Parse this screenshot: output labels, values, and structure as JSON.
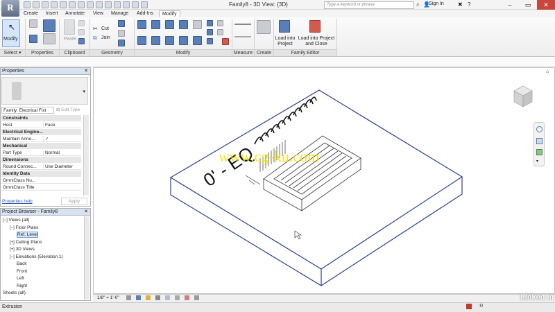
{
  "window": {
    "title": "Family8 - 3D View: {3D}",
    "search_placeholder": "Type a keyword or phrase",
    "sign_in": "Sign In",
    "app_letter": "R"
  },
  "ribbon_tabs": [
    "Create",
    "Insert",
    "Annotate",
    "View",
    "Manage",
    "Add-Ins",
    "Modify"
  ],
  "ribbon": {
    "modify_button": "Modify",
    "select_dropdown": "Select",
    "panels": [
      "Properties",
      "Clipboard",
      "Geometry",
      "Modify",
      "Measure",
      "Create",
      "Family Editor"
    ],
    "paste_label": "Paste",
    "cut_label": "Cut",
    "join_label": "Join",
    "load_project": "Load into Project",
    "load_project_close": "Load into Project and Close"
  },
  "properties": {
    "title": "Properties",
    "family_selector": "Family: Electrical Fixt",
    "edit_type": "Edit Type",
    "rows": [
      {
        "group": "Constraints"
      },
      {
        "k": "Host",
        "v": "Face"
      },
      {
        "group": "Electrical Engine..."
      },
      {
        "k": "Maintain Anno...",
        "v": "✓"
      },
      {
        "group": "Mechanical"
      },
      {
        "k": "Part Type",
        "v": "Normal"
      },
      {
        "group": "Dimensions"
      },
      {
        "k": "Round Connec...",
        "v": "Use Diameter"
      },
      {
        "group": "Identity Data"
      },
      {
        "k": "OmniClass Nu...",
        "v": ""
      },
      {
        "k": "OmniClass Title",
        "v": ""
      }
    ],
    "help_link": "Properties help",
    "apply_button": "Apply"
  },
  "project_browser": {
    "title": "Project Browser - Family8",
    "items": [
      {
        "label": "Views (all)",
        "indent": 0,
        "toggle": "−"
      },
      {
        "label": "Floor Plans",
        "indent": 1,
        "toggle": "−"
      },
      {
        "label": "Ref. Level",
        "indent": 2,
        "toggle": "",
        "selected": true
      },
      {
        "label": "Ceiling Plans",
        "indent": 1,
        "toggle": "+"
      },
      {
        "label": "3D Views",
        "indent": 1,
        "toggle": "+"
      },
      {
        "label": "Elevations (Elevation 1)",
        "indent": 1,
        "toggle": "−"
      },
      {
        "label": "Back",
        "indent": 2,
        "toggle": ""
      },
      {
        "label": "Front",
        "indent": 2,
        "toggle": ""
      },
      {
        "label": "Left",
        "indent": 2,
        "toggle": ""
      },
      {
        "label": "Right",
        "indent": 2,
        "toggle": ""
      },
      {
        "label": "Sheets (all)",
        "indent": 0,
        "toggle": ""
      }
    ]
  },
  "view": {
    "dimension_text": "0' - EQ",
    "watermark": "www.cg-ku.com",
    "scale": "1/8\" = 1'-0\""
  },
  "status": {
    "left_text": "Extrusion",
    "count": ":0"
  },
  "brand": "Linked in",
  "colors": {
    "accent": "#5a7fb8",
    "model_lines": "#2b3f8f",
    "close": "#c9463d"
  }
}
